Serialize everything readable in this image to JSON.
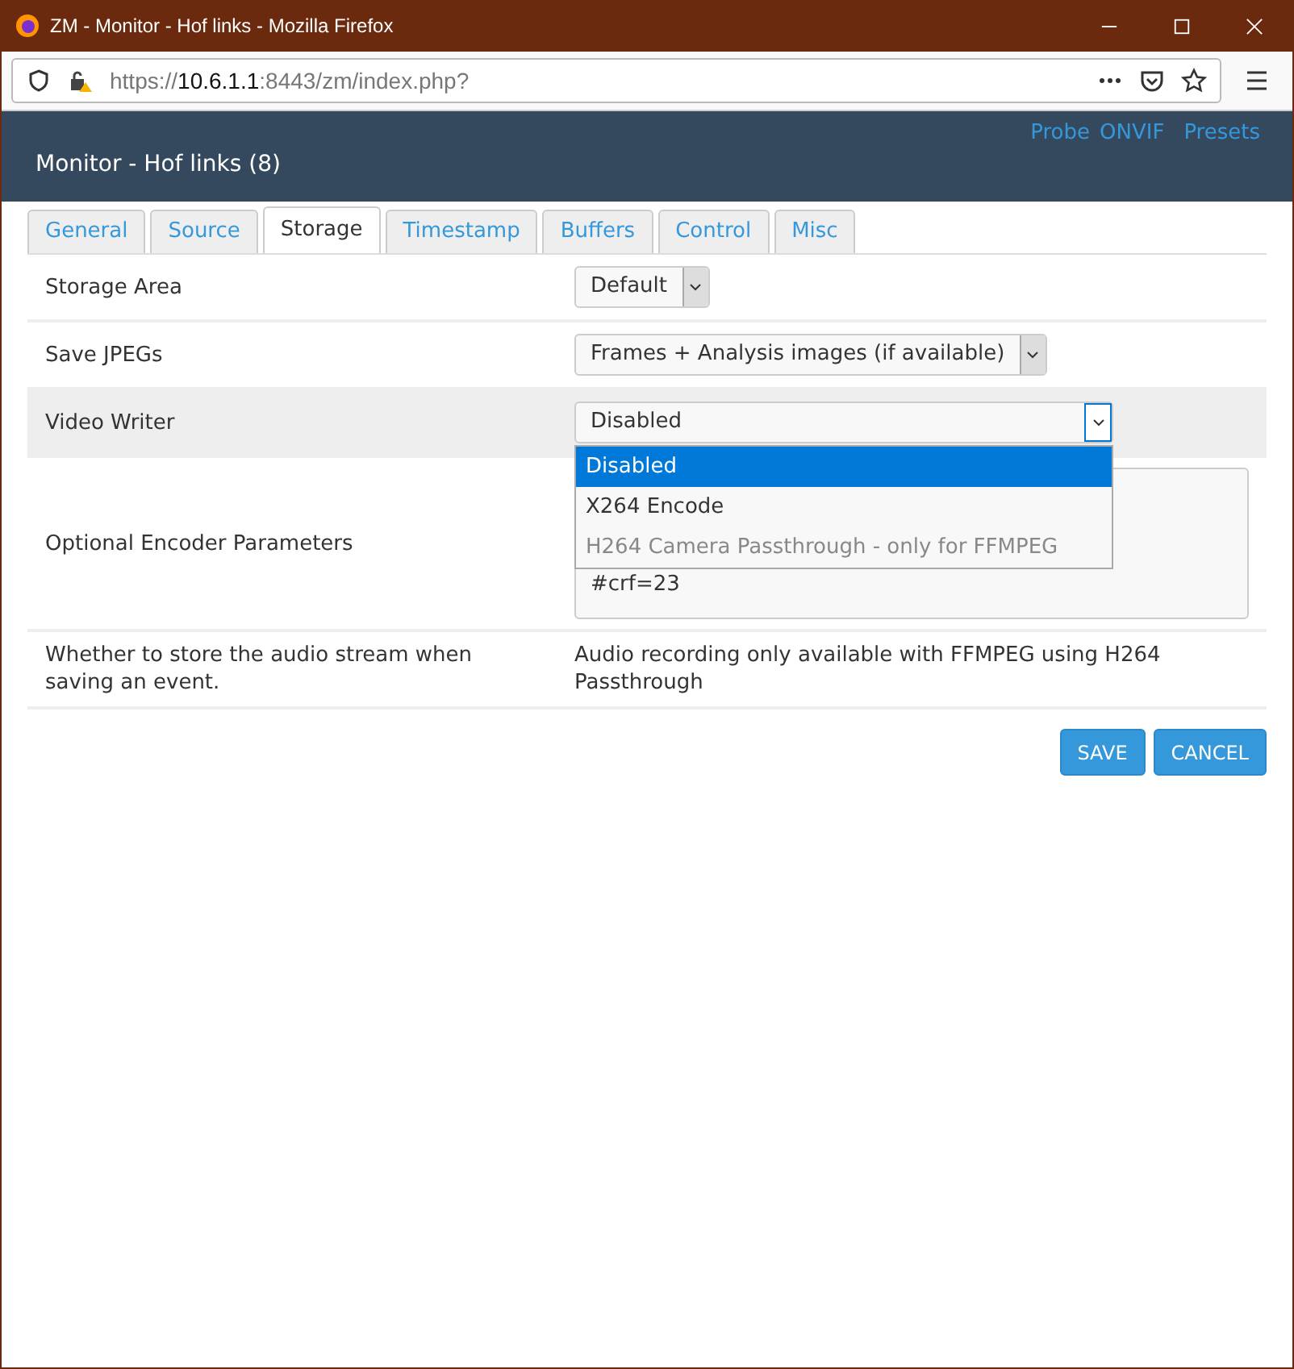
{
  "window": {
    "title": "ZM - Monitor - Hof links - Mozilla Firefox"
  },
  "address_bar": {
    "url_prefix": "https://",
    "url_host": "10.6.1.1",
    "url_rest": ":8443/zm/index.php?"
  },
  "header": {
    "title": "Monitor - Hof links (8)",
    "links": [
      "Probe",
      "ONVIF",
      "Presets"
    ]
  },
  "tabs": [
    {
      "label": "General",
      "selected": false
    },
    {
      "label": "Source",
      "selected": false
    },
    {
      "label": "Storage",
      "selected": true
    },
    {
      "label": "Timestamp",
      "selected": false
    },
    {
      "label": "Buffers",
      "selected": false
    },
    {
      "label": "Control",
      "selected": false
    },
    {
      "label": "Misc",
      "selected": false
    }
  ],
  "rows": [
    {
      "kind": "select",
      "label": "Storage Area",
      "value": "Default",
      "highlighted": false
    },
    {
      "kind": "select",
      "label": "Save JPEGs",
      "value": "Frames + Analysis images (if available)",
      "highlighted": false
    },
    {
      "kind": "open-select",
      "label": "Video Writer",
      "value": "Disabled",
      "highlighted": true,
      "options": [
        {
          "label": "Disabled",
          "selected": true,
          "disabled": false
        },
        {
          "label": "X264 Encode",
          "selected": false,
          "disabled": false
        },
        {
          "label": "H264 Camera Passthrough - only for FFMPEG",
          "selected": false,
          "disabled": true
        }
      ]
    },
    {
      "kind": "textarea",
      "label": "Optional Encoder Parameters",
      "value": "#crf=23",
      "highlighted": false
    },
    {
      "kind": "text",
      "label": "Whether to store the audio stream when saving an event.",
      "value": "Audio recording only available with FFMPEG using H264 Passthrough",
      "highlighted": false
    }
  ],
  "buttons": [
    "SAVE",
    "CANCEL"
  ]
}
